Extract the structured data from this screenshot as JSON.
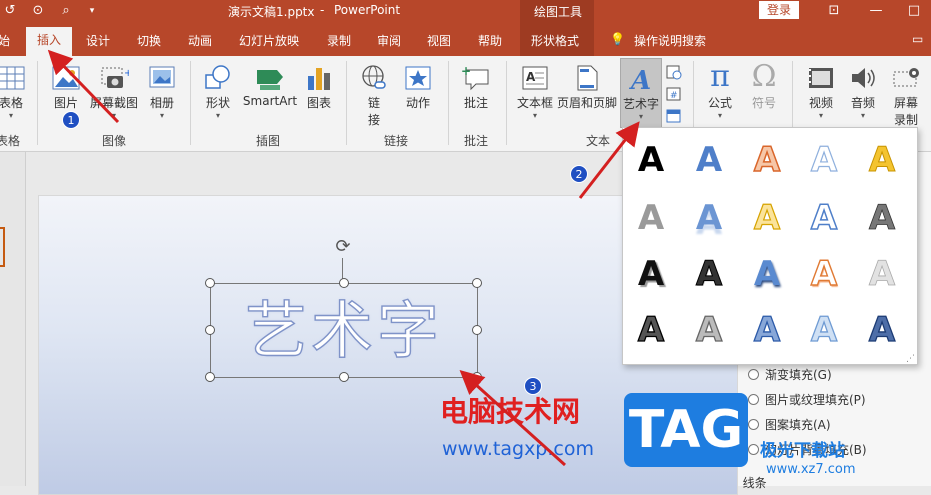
{
  "titlebar": {
    "filename": "演示文稿1.pptx",
    "separator": "-",
    "app": "PowerPoint",
    "context_tools": "绘图工具",
    "login": "登录"
  },
  "tabs": {
    "partial_left": "始",
    "insert": "插入",
    "design": "设计",
    "transitions": "切换",
    "animations": "动画",
    "slideshow": "幻灯片放映",
    "record": "录制",
    "review": "审阅",
    "view": "视图",
    "help": "帮助",
    "shape_format": "形状格式",
    "tell_me": "操作说明搜索"
  },
  "ribbon": {
    "table": "表格",
    "table_group": "表格",
    "picture": "图片",
    "screenshot": "屏幕截图",
    "album": "相册",
    "images_group": "图像",
    "shapes": "形状",
    "smartart": "SmartArt",
    "chart": "图表",
    "illustrations_group": "插图",
    "link": "链\n接",
    "link_l1": "链",
    "link_l2": "接",
    "action": "动作",
    "links_group": "链接",
    "comment": "批注",
    "comments_group": "批注",
    "textbox": "文本框",
    "header_footer": "页眉和页脚",
    "wordart": "艺术字",
    "text_group": "文本",
    "equation": "公式",
    "symbol": "符号",
    "video": "视频",
    "audio": "音频",
    "screen_rec_l1": "屏幕",
    "screen_rec_l2": "录制"
  },
  "format_pane": {
    "gradient_fill": "渐变填充(G)",
    "picture_fill": "图片或纹理填充(P)",
    "pattern_fill": "图案填充(A)",
    "slide_bg_fill": "幻灯片背景填充(B)",
    "line": "线条"
  },
  "slide": {
    "wordart_text": "艺术字"
  },
  "gallery": {
    "glyph": "A",
    "styles": [
      "black-plain",
      "blue-gradient",
      "orange-outline",
      "pale-blue-outline",
      "gold-fill",
      "gray-gradient",
      "blue-reflection",
      "gold-outline",
      "blue-outline",
      "gray-metallic",
      "black-shadow",
      "black-bevel",
      "blue-bevel",
      "orange-bevel",
      "silver",
      "black-pattern",
      "gray-pattern",
      "blue-pattern",
      "lightblue-pattern",
      "navy-pattern"
    ]
  },
  "annotations": {
    "step1": "1",
    "step2": "2",
    "step3": "3"
  },
  "watermarks": {
    "site_cn": "电脑技术网",
    "url": "www.tagxp.com",
    "tag": "TAG",
    "site2": "极光下载站",
    "url2": "www.xz7.com"
  },
  "colors": {
    "accent": "#b7472a",
    "accent_dark": "#9e3b22",
    "arrow": "#d42020",
    "badge": "#1f4fc2"
  }
}
